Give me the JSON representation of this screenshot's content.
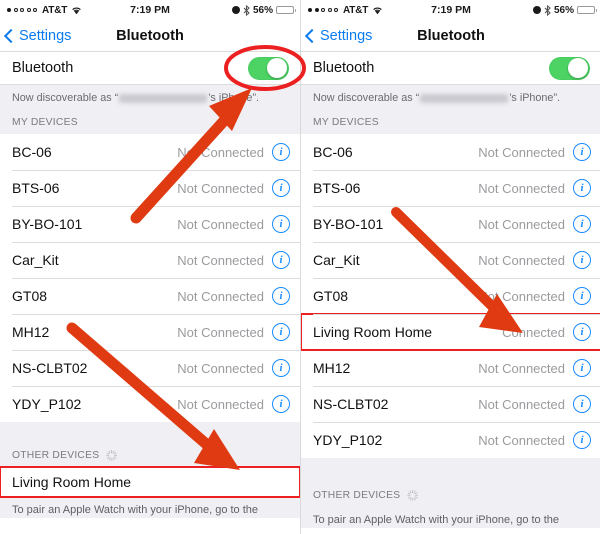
{
  "status_bar": {
    "carrier": "AT&T",
    "time": "7:19 PM",
    "battery_percent": "56%",
    "left_signal_dots_filled": 1,
    "right_signal_dots_filled": 2,
    "icons": [
      "signal-dots-icon",
      "wifi-icon",
      "alarm-clock-icon",
      "bluetooth-icon",
      "battery-icon"
    ]
  },
  "nav": {
    "back_label": "Settings",
    "title": "Bluetooth"
  },
  "bluetooth": {
    "label": "Bluetooth",
    "toggle_state": "on",
    "toggle_color": "#4cd364"
  },
  "discoverable": {
    "prefix": "Now discoverable as “",
    "blurred_name": "Redacted Name",
    "suffix": "’s iPhone”."
  },
  "sections": {
    "my_devices": "MY DEVICES",
    "other_devices": "OTHER DEVICES"
  },
  "status_text": {
    "connected": "Connected",
    "not_connected": "Not Connected"
  },
  "left_panel": {
    "my_devices": [
      {
        "name": "BC-06",
        "status": "Not Connected",
        "highlight": false
      },
      {
        "name": "BTS-06",
        "status": "Not Connected",
        "highlight": false
      },
      {
        "name": "BY-BO-101",
        "status": "Not Connected",
        "highlight": false
      },
      {
        "name": "Car_Kit",
        "status": "Not Connected",
        "highlight": false
      },
      {
        "name": "GT08",
        "status": "Not Connected",
        "highlight": false
      },
      {
        "name": "MH12",
        "status": "Not Connected",
        "highlight": false
      },
      {
        "name": "NS-CLBT02",
        "status": "Not Connected",
        "highlight": false
      },
      {
        "name": "YDY_P102",
        "status": "Not Connected",
        "highlight": false
      }
    ],
    "other_devices": [
      {
        "name": "Living Room Home",
        "highlight": true
      }
    ],
    "footer": "To pair an Apple Watch with your iPhone, go to the"
  },
  "right_panel": {
    "my_devices": [
      {
        "name": "BC-06",
        "status": "Not Connected",
        "highlight": false
      },
      {
        "name": "BTS-06",
        "status": "Not Connected",
        "highlight": false
      },
      {
        "name": "BY-BO-101",
        "status": "Not Connected",
        "highlight": false
      },
      {
        "name": "Car_Kit",
        "status": "Not Connected",
        "highlight": false
      },
      {
        "name": "GT08",
        "status": "Not Connected",
        "highlight": false
      },
      {
        "name": "Living Room Home",
        "status": "Connected",
        "highlight": true
      },
      {
        "name": "MH12",
        "status": "Not Connected",
        "highlight": false
      },
      {
        "name": "NS-CLBT02",
        "status": "Not Connected",
        "highlight": false
      },
      {
        "name": "YDY_P102",
        "status": "Not Connected",
        "highlight": false
      }
    ],
    "other_devices": [],
    "footer": "To pair an Apple Watch with your iPhone, go to the"
  },
  "annotations": {
    "color": "#e03a12",
    "highlight_color": "#ec2020",
    "ellipse_label": "toggle-highlight-ellipse",
    "arrows": [
      {
        "name": "arrow-to-bluetooth-toggle"
      },
      {
        "name": "arrow-to-other-device"
      },
      {
        "name": "arrow-to-connected-device"
      }
    ]
  }
}
